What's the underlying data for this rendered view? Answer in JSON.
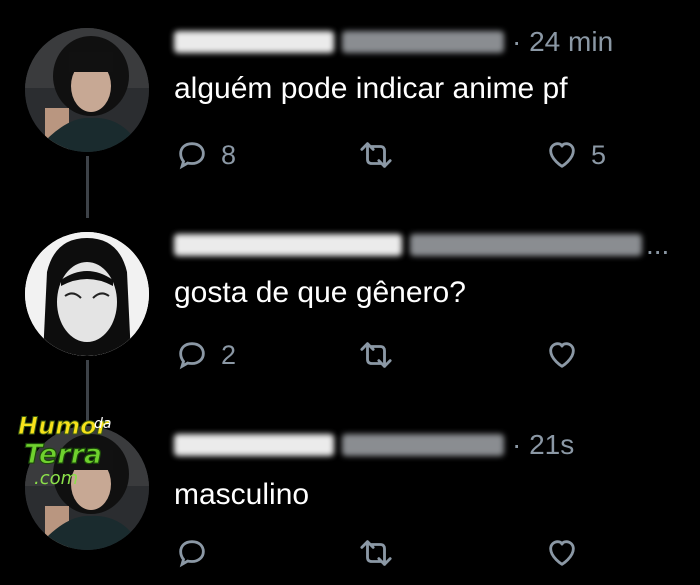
{
  "tweets": [
    {
      "time": "· 24 min",
      "text": "alguém pode indicar anime pf",
      "replies": "8",
      "retweets": "",
      "likes": "5"
    },
    {
      "time": "...",
      "text": "gosta de que gênero?",
      "replies": "2",
      "retweets": "",
      "likes": ""
    },
    {
      "time": "· 21s",
      "text": "masculino",
      "replies": "",
      "retweets": "",
      "likes": ""
    }
  ],
  "watermark": {
    "line1": "Humor",
    "line1b": "da",
    "line2": "Terra",
    "line3": ".com"
  },
  "colors": {
    "background": "#000000",
    "text": "#ffffff",
    "muted": "#8b98a5",
    "thread_line": "#3d4248"
  },
  "icons": [
    "reply-icon",
    "retweet-icon",
    "like-icon"
  ]
}
